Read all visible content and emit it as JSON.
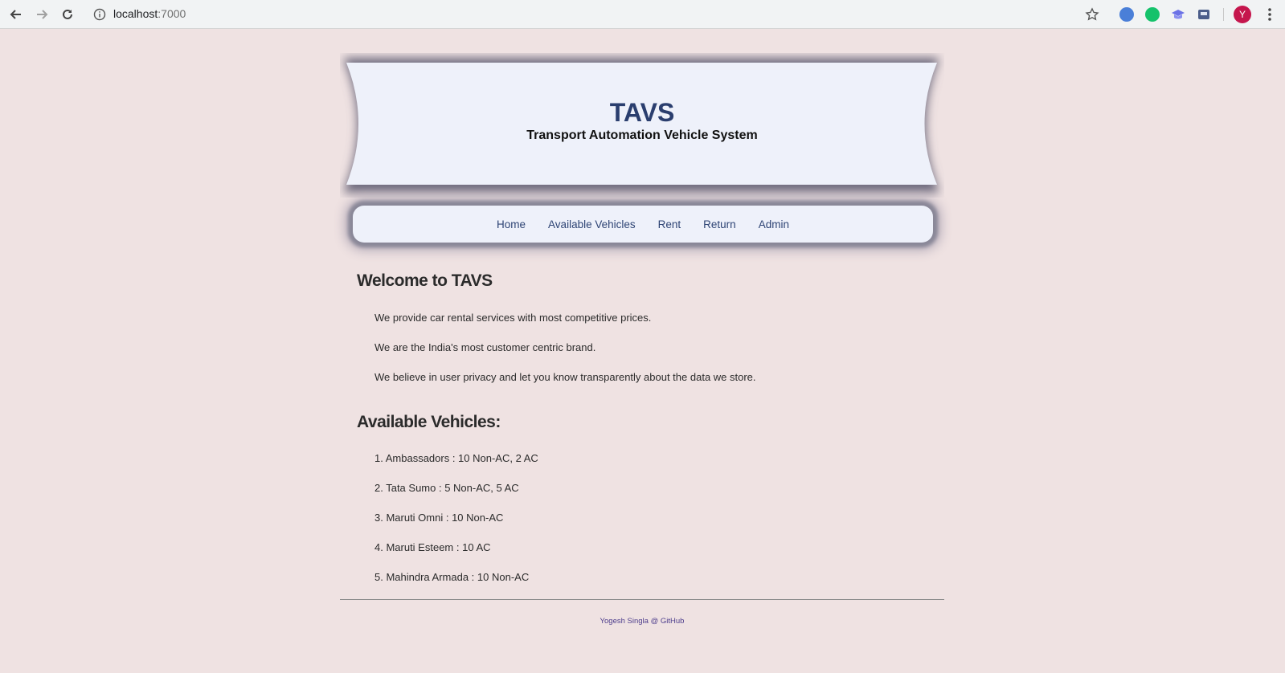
{
  "browser": {
    "url_host": "localhost",
    "url_port": ":7000",
    "avatar_letter": "Y"
  },
  "header": {
    "title": "TAVS",
    "subtitle": "Transport Automation Vehicle System"
  },
  "nav": {
    "items": [
      "Home",
      "Available Vehicles",
      "Rent",
      "Return",
      "Admin"
    ]
  },
  "welcome": {
    "heading": "Welcome to TAVS",
    "lines": [
      "We provide car rental services with most competitive prices.",
      "We are the India's most customer centric brand.",
      "We believe in user privacy and let you know transparently about the data we store."
    ]
  },
  "vehicles": {
    "heading": "Available Vehicles:",
    "items": [
      "1. Ambassadors : 10 Non-AC, 2 AC",
      "2. Tata Sumo : 5 Non-AC, 5 AC",
      "3. Maruti Omni : 10 Non-AC",
      "4. Maruti Esteem : 10 AC",
      "5. Mahindra Armada : 10 Non-AC"
    ]
  },
  "footer": {
    "text": "Yogesh Singla @ GitHub"
  },
  "colors": {
    "page_bg": "#efe2e2",
    "panel_bg": "#eef1fa",
    "title": "#2a3e6e",
    "link": "#2e4474",
    "footer_link": "#4d3d8c"
  }
}
